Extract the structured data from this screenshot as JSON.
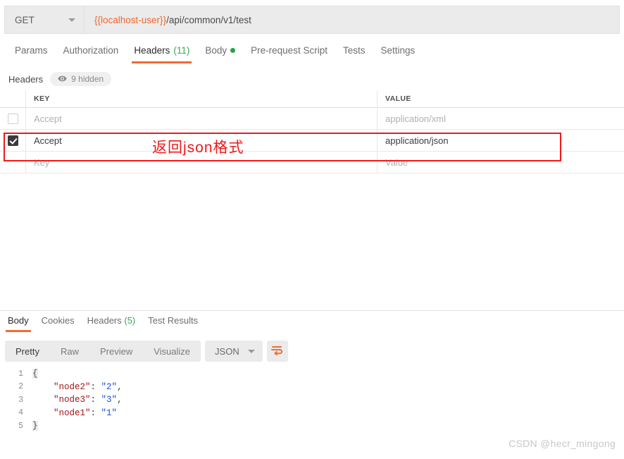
{
  "request": {
    "method": "GET",
    "url_variable": "{{localhost-user}}",
    "url_path": "/api/common/v1/test",
    "tabs": [
      {
        "label": "Params",
        "active": false,
        "count": "",
        "dot": false
      },
      {
        "label": "Authorization",
        "active": false,
        "count": "",
        "dot": false
      },
      {
        "label": "Headers",
        "active": true,
        "count": "(11)",
        "dot": false
      },
      {
        "label": "Body",
        "active": false,
        "count": "",
        "dot": true
      },
      {
        "label": "Pre-request Script",
        "active": false,
        "count": "",
        "dot": false
      },
      {
        "label": "Tests",
        "active": false,
        "count": "",
        "dot": false
      },
      {
        "label": "Settings",
        "active": false,
        "count": "",
        "dot": false
      }
    ]
  },
  "headers_panel": {
    "section_label": "Headers",
    "hidden_label": "9 hidden",
    "eye_icon": "eye-icon",
    "columns": {
      "key": "KEY",
      "value": "VALUE"
    },
    "rows": [
      {
        "checked": false,
        "key": "Accept",
        "value": "application/xml",
        "muted": true
      },
      {
        "checked": true,
        "key": "Accept",
        "value": "application/json",
        "muted": false
      },
      {
        "checked": false,
        "key": "Key",
        "value": "Value",
        "muted": true
      }
    ]
  },
  "annotation": {
    "text": "返回json格式",
    "color": "#ef1a1a"
  },
  "response": {
    "tabs": [
      {
        "label": "Body",
        "active": true,
        "count": ""
      },
      {
        "label": "Cookies",
        "active": false,
        "count": ""
      },
      {
        "label": "Headers",
        "active": false,
        "count": "(5)"
      },
      {
        "label": "Test Results",
        "active": false,
        "count": ""
      }
    ],
    "view_modes": [
      {
        "label": "Pretty",
        "active": true
      },
      {
        "label": "Raw",
        "active": false
      },
      {
        "label": "Preview",
        "active": false
      },
      {
        "label": "Visualize",
        "active": false
      }
    ],
    "format": "JSON",
    "wrap_icon": "word-wrap-icon",
    "code_lines": [
      {
        "n": "1",
        "segments": [
          {
            "t": "{",
            "c": "tok-brace"
          }
        ]
      },
      {
        "n": "2",
        "segments": [
          {
            "t": "    ",
            "c": "tok-punc"
          },
          {
            "t": "\"node2\"",
            "c": "tok-key"
          },
          {
            "t": ": ",
            "c": "tok-punc"
          },
          {
            "t": "\"2\"",
            "c": "tok-str"
          },
          {
            "t": ",",
            "c": "tok-punc"
          }
        ]
      },
      {
        "n": "3",
        "segments": [
          {
            "t": "    ",
            "c": "tok-punc"
          },
          {
            "t": "\"node3\"",
            "c": "tok-key"
          },
          {
            "t": ": ",
            "c": "tok-punc"
          },
          {
            "t": "\"3\"",
            "c": "tok-str"
          },
          {
            "t": ",",
            "c": "tok-punc"
          }
        ]
      },
      {
        "n": "4",
        "segments": [
          {
            "t": "    ",
            "c": "tok-punc"
          },
          {
            "t": "\"node1\"",
            "c": "tok-key"
          },
          {
            "t": ": ",
            "c": "tok-punc"
          },
          {
            "t": "\"1\"",
            "c": "tok-str"
          }
        ]
      },
      {
        "n": "5",
        "segments": [
          {
            "t": "}",
            "c": "tok-brace"
          }
        ]
      }
    ]
  },
  "watermark": "CSDN @hecr_mingong"
}
